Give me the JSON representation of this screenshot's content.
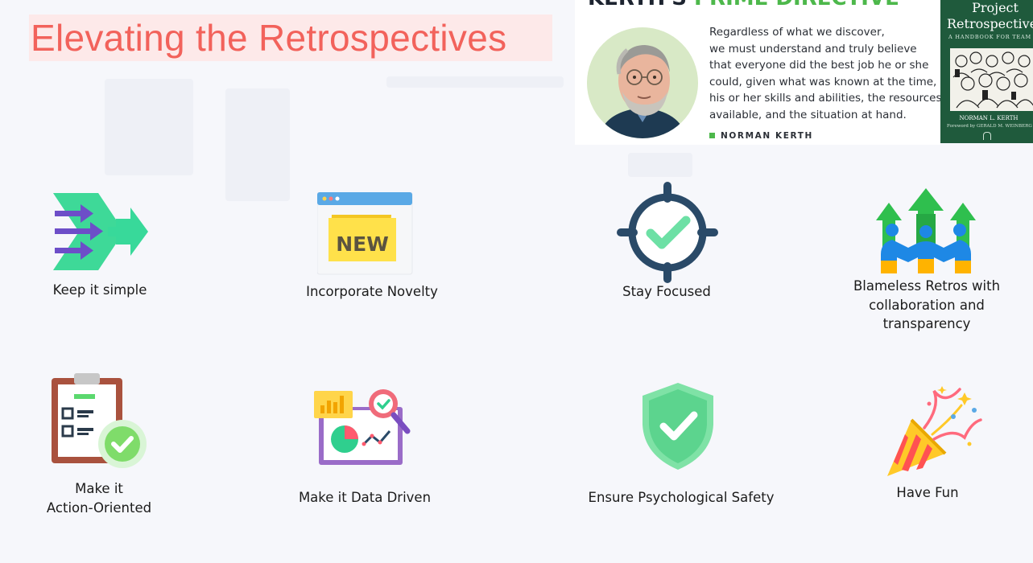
{
  "slide": {
    "title": "Elevating the Retrospectives"
  },
  "quote_card": {
    "heading_dark": "KERTH'S ",
    "heading_green": "PRIME DIRECTIVE",
    "lines": [
      "Regardless of what we discover,",
      "we must understand and truly believe",
      "that everyone did the best job he or she",
      "could, given what was known at the time,",
      "his or her skills and abilities, the resources",
      "available, and the situation at hand."
    ],
    "author": "NORMAN KERTH"
  },
  "book": {
    "title_line1": "Project",
    "title_line2": "Retrospectives",
    "subtitle": "A HANDBOOK FOR TEAM REVIEWS",
    "author": "NORMAN L. KERTH",
    "foreword": "Foreword by GERALD M. WEINBERG"
  },
  "items": {
    "simple": "Keep it simple",
    "novelty": "Incorporate Novelty",
    "novelty_badge": "NEW",
    "focused": "Stay Focused",
    "blameless_1": "Blameless Retros with",
    "blameless_2": "collaboration and",
    "blameless_3": "transparency",
    "action_1": "Make it",
    "action_2": "Action-Oriented",
    "data": "Make it Data Driven",
    "safety": "Ensure Psychological Safety",
    "fun": "Have Fun"
  },
  "colors": {
    "title": "#f2625b",
    "title_highlight": "#fde9e9",
    "green_accent": "#4db84b",
    "book_green": "#1f5a3c",
    "background": "#f6f7fb"
  }
}
